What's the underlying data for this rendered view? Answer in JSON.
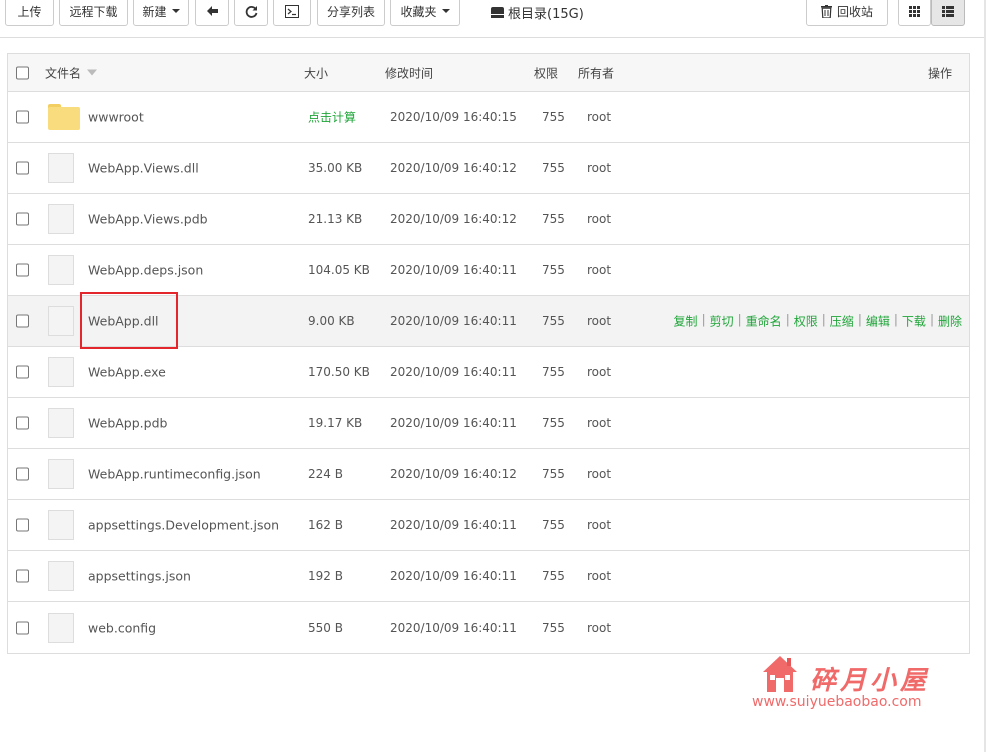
{
  "toolbar": {
    "upload": "上传",
    "remote_download": "远程下载",
    "new": "新建",
    "share_list": "分享列表",
    "favorites": "收藏夹",
    "path": "根目录(15G)",
    "recycle_bin": "回收站"
  },
  "table": {
    "headers": {
      "name": "文件名",
      "size": "大小",
      "mtime": "修改时间",
      "perm": "权限",
      "owner": "所有者",
      "ops": "操作"
    },
    "rows": [
      {
        "name": "wwwroot",
        "size": "点击计算",
        "mtime": "2020/10/09 16:40:15",
        "perm": "755",
        "owner": "root",
        "type": "folder"
      },
      {
        "name": "WebApp.Views.dll",
        "size": "35.00 KB",
        "mtime": "2020/10/09 16:40:12",
        "perm": "755",
        "owner": "root",
        "type": "file"
      },
      {
        "name": "WebApp.Views.pdb",
        "size": "21.13 KB",
        "mtime": "2020/10/09 16:40:12",
        "perm": "755",
        "owner": "root",
        "type": "file"
      },
      {
        "name": "WebApp.deps.json",
        "size": "104.05 KB",
        "mtime": "2020/10/09 16:40:11",
        "perm": "755",
        "owner": "root",
        "type": "file"
      },
      {
        "name": "WebApp.dll",
        "size": "9.00 KB",
        "mtime": "2020/10/09 16:40:11",
        "perm": "755",
        "owner": "root",
        "type": "file"
      },
      {
        "name": "WebApp.exe",
        "size": "170.50 KB",
        "mtime": "2020/10/09 16:40:11",
        "perm": "755",
        "owner": "root",
        "type": "file"
      },
      {
        "name": "WebApp.pdb",
        "size": "19.17 KB",
        "mtime": "2020/10/09 16:40:11",
        "perm": "755",
        "owner": "root",
        "type": "file"
      },
      {
        "name": "WebApp.runtimeconfig.json",
        "size": "224 B",
        "mtime": "2020/10/09 16:40:12",
        "perm": "755",
        "owner": "root",
        "type": "file"
      },
      {
        "name": "appsettings.Development.json",
        "size": "162 B",
        "mtime": "2020/10/09 16:40:11",
        "perm": "755",
        "owner": "root",
        "type": "file"
      },
      {
        "name": "appsettings.json",
        "size": "192 B",
        "mtime": "2020/10/09 16:40:11",
        "perm": "755",
        "owner": "root",
        "type": "file"
      },
      {
        "name": "web.config",
        "size": "550 B",
        "mtime": "2020/10/09 16:40:11",
        "perm": "755",
        "owner": "root",
        "type": "file"
      }
    ],
    "row_ops": [
      "复制",
      "剪切",
      "重命名",
      "权限",
      "压缩",
      "编辑",
      "下载",
      "删除"
    ]
  },
  "watermark": {
    "title": "碎月小屋",
    "url": "www.suiyuebaobao.com"
  },
  "colors": {
    "accent_green": "#20a53a",
    "highlight_red": "#e3262b",
    "watermark": "#f06a6a"
  }
}
